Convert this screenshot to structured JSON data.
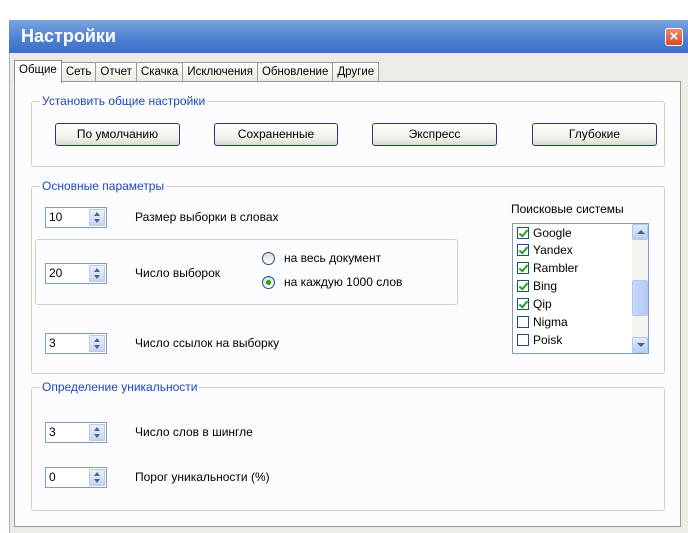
{
  "window": {
    "title": "Настройки",
    "close_glyph": "×"
  },
  "tabs": [
    "Общие",
    "Сеть",
    "Отчет",
    "Скачка",
    "Исключения",
    "Обновление",
    "Другие"
  ],
  "general_settings": {
    "legend": "Установить общие настройки",
    "buttons": [
      "По умолчанию",
      "Сохраненные",
      "Экспресс",
      "Глубокие"
    ]
  },
  "main_params": {
    "legend": "Основные параметры",
    "sample_size": {
      "value": "10",
      "label": "Размер выборки в словах"
    },
    "sample_count": {
      "value": "20",
      "label": "Число выборок"
    },
    "radio_options": [
      "на весь документ",
      "на каждую 1000 слов"
    ],
    "radio_selected": 1,
    "links_per_sample": {
      "value": "3",
      "label": "Число ссылок на выборку"
    }
  },
  "search_engines": {
    "label": "Поисковые системы",
    "items": [
      {
        "name": "Google",
        "checked": true
      },
      {
        "name": "Yandex",
        "checked": true
      },
      {
        "name": "Rambler",
        "checked": true
      },
      {
        "name": "Bing",
        "checked": true
      },
      {
        "name": "Qip",
        "checked": true
      },
      {
        "name": "Nigma",
        "checked": false
      },
      {
        "name": "Poisk",
        "checked": false
      }
    ]
  },
  "uniqueness": {
    "legend": "Определение уникальности",
    "shingle_words": {
      "value": "3",
      "label": "Число слов в шингле"
    },
    "threshold": {
      "value": "0",
      "label": "Порог уникальности (%)"
    }
  },
  "colors": {
    "title_bar": "#4f82d3",
    "legend_text": "#1f48b8",
    "check": "#21a121"
  }
}
